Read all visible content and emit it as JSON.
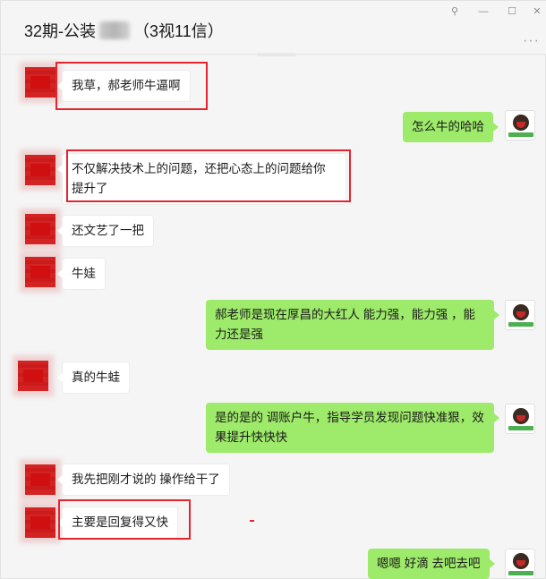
{
  "window": {
    "title_prefix": "32期-公装",
    "title_suffix": "（3视11信）",
    "controls": {
      "pin": "⚲",
      "minimize": "—",
      "maximize": "☐",
      "close": "✕"
    },
    "more": "···"
  },
  "messages": [
    {
      "side": "left",
      "text": "我草，郝老师牛逼啊"
    },
    {
      "side": "right",
      "text": "怎么牛的哈哈"
    },
    {
      "side": "left",
      "text": "不仅解决技术上的问题，还把心态上的问题给你提升了"
    },
    {
      "side": "left",
      "text": "还文艺了一把"
    },
    {
      "side": "left",
      "text": "牛娃"
    },
    {
      "side": "right",
      "text": "郝老师是现在厚昌的大红人   能力强，能力强 ，能力还是强"
    },
    {
      "side": "left",
      "text": "真的牛蛙"
    },
    {
      "side": "right",
      "text": "是的是的    调账户牛，指导学员发现问题快准狠，效果提升快快快"
    },
    {
      "side": "left",
      "text": "我先把刚才说的 操作给干了"
    },
    {
      "side": "left",
      "text": "主要是回复得又快"
    },
    {
      "side": "right",
      "text": "嗯嗯 好滴  去吧去吧"
    }
  ],
  "colors": {
    "highlight": "#e4252e",
    "right_bubble": "#9eea6a",
    "left_bubble": "#ffffff",
    "background": "#f5f5f5"
  }
}
